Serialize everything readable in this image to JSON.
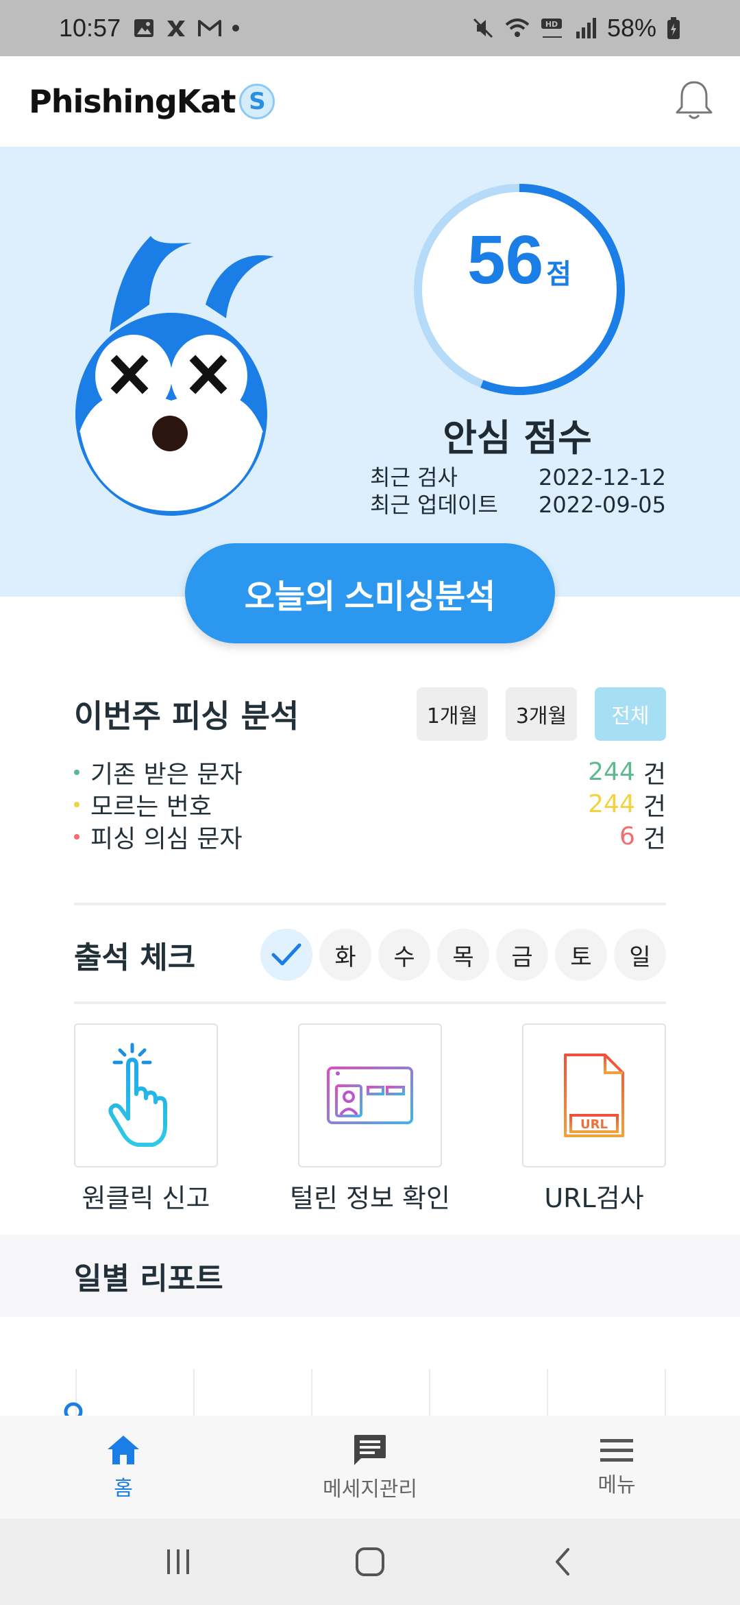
{
  "status_bar": {
    "time": "10:57",
    "battery": "58%"
  },
  "header": {
    "logo_text": "PhishingKat",
    "logo_badge": "S"
  },
  "score": {
    "value": "56",
    "unit": "점",
    "title": "안심 점수",
    "ring_fraction": 0.56,
    "meta": [
      {
        "label": "최근 검사",
        "value": "2022-12-12"
      },
      {
        "label": "최근 업데이트",
        "value": "2022-09-05"
      }
    ]
  },
  "cta": {
    "label": "오늘의 스미싱분석"
  },
  "weekly": {
    "title": "이번주 피싱 분석",
    "tabs": [
      "1개월",
      "3개월",
      "전체"
    ],
    "active_tab": "전체",
    "stats": [
      {
        "label": "기존 받은 문자",
        "value": "244",
        "unit": "건",
        "color": "#5fb98f"
      },
      {
        "label": "모르는 번호",
        "value": "244",
        "unit": "건",
        "color": "#f3d23e"
      },
      {
        "label": "피싱 의심 문자",
        "value": "6",
        "unit": "건",
        "color": "#f26d6d"
      }
    ]
  },
  "attendance": {
    "title": "출석 체크",
    "days": [
      "화",
      "수",
      "목",
      "금",
      "토",
      "일"
    ],
    "checked_icon": "checkmark-icon"
  },
  "features": [
    {
      "label": "원클릭 신고",
      "icon": "tap-hand-icon"
    },
    {
      "label": "털린 정보 확인",
      "icon": "id-card-icon"
    },
    {
      "label": "URL검사",
      "icon": "url-document-icon",
      "icon_text": "URL"
    }
  ],
  "daily_report": {
    "title": "일별 리포트"
  },
  "bottom_nav": [
    {
      "label": "홈",
      "icon": "home-icon",
      "active": true
    },
    {
      "label": "메세지관리",
      "icon": "message-icon",
      "active": false
    },
    {
      "label": "메뉴",
      "icon": "menu-icon",
      "active": false
    }
  ],
  "colors": {
    "accent": "#1b7ee6",
    "cta": "#2b97ee",
    "hero_bg": "#ddeffd",
    "active_tab": "#a6def3"
  }
}
